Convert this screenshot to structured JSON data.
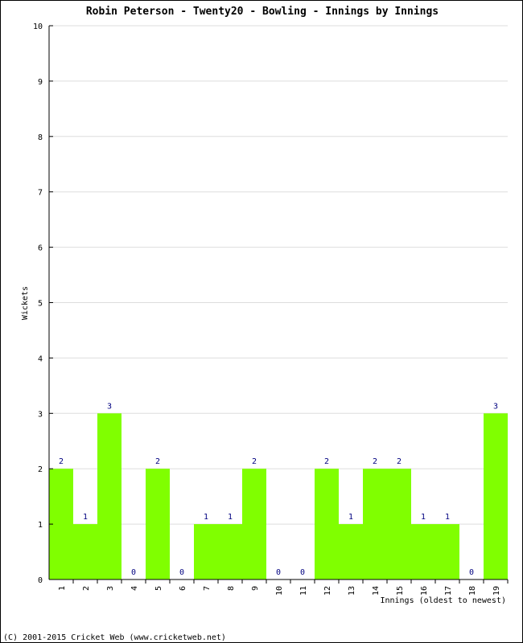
{
  "chart_data": {
    "type": "bar",
    "title": "Robin Peterson - Twenty20 - Bowling - Innings by Innings",
    "xlabel": "Innings (oldest to newest)",
    "ylabel": "Wickets",
    "ylim": [
      0,
      10
    ],
    "yticks": [
      "0",
      "1",
      "2",
      "3",
      "4",
      "5",
      "6",
      "7",
      "8",
      "9",
      "10"
    ],
    "grid": true,
    "bar_color": "#80ff00",
    "label_color": "#000080",
    "grid_color": "#dddddd",
    "categories": [
      "1",
      "2",
      "3",
      "4",
      "5",
      "6",
      "7",
      "8",
      "9",
      "10",
      "11",
      "12",
      "13",
      "14",
      "15",
      "16",
      "17",
      "18",
      "19"
    ],
    "values": [
      2,
      1,
      3,
      0,
      2,
      0,
      1,
      1,
      2,
      0,
      0,
      2,
      1,
      2,
      2,
      1,
      1,
      0,
      3
    ]
  },
  "footer": "(C) 2001-2015 Cricket Web (www.cricketweb.net)"
}
